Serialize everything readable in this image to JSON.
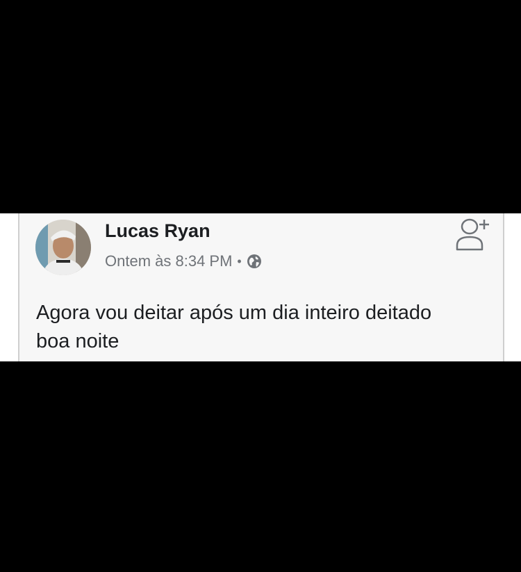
{
  "post": {
    "author": "Lucas Ryan",
    "timestamp": "Ontem às 8:34 PM",
    "separator": "•",
    "privacy_icon": "globe-icon",
    "add_friend_icon": "add-friend-icon",
    "text": "Agora vou deitar após um dia inteiro deitado boa noite"
  },
  "colors": {
    "background": "#000000",
    "card": "#f7f7f7",
    "name": "#1c1e21",
    "meta": "#6f7378"
  }
}
